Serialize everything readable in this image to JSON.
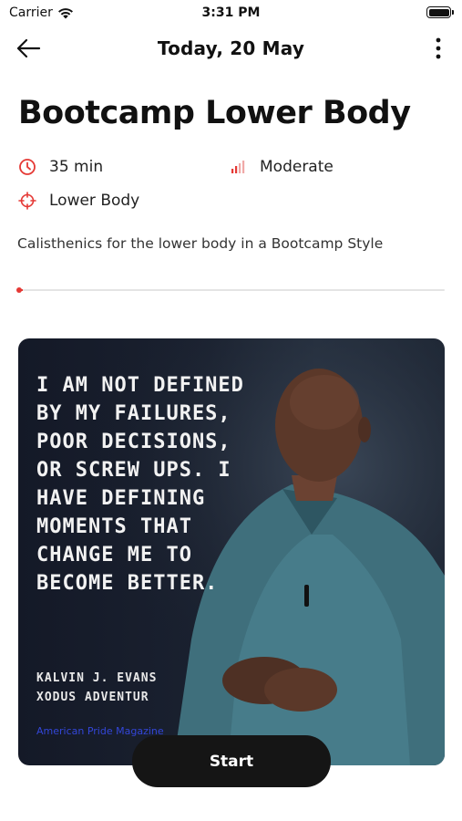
{
  "status_bar": {
    "carrier": "Carrier",
    "time": "3:31 PM"
  },
  "nav": {
    "title": "Today, 20 May",
    "back_icon": "arrow-left-icon",
    "more_icon": "more-vertical-icon"
  },
  "workout": {
    "title": "Bootcamp Lower Body",
    "duration": "35 min",
    "intensity": "Moderate",
    "focus": "Lower Body",
    "description": "Calisthenics for the lower body in a Bootcamp Style",
    "progress_fraction": 0.01
  },
  "card": {
    "quote": "I am not defined by my failures, poor decisions, or screw ups. I have defining moments that change me to become better.",
    "author": "KALVIN J. EVANS\nXODUS ADVENTUR",
    "credit": "American Pride Magazine"
  },
  "start_button": {
    "label": "Start"
  },
  "colors": {
    "accent": "#e53935",
    "button": "#151515"
  }
}
